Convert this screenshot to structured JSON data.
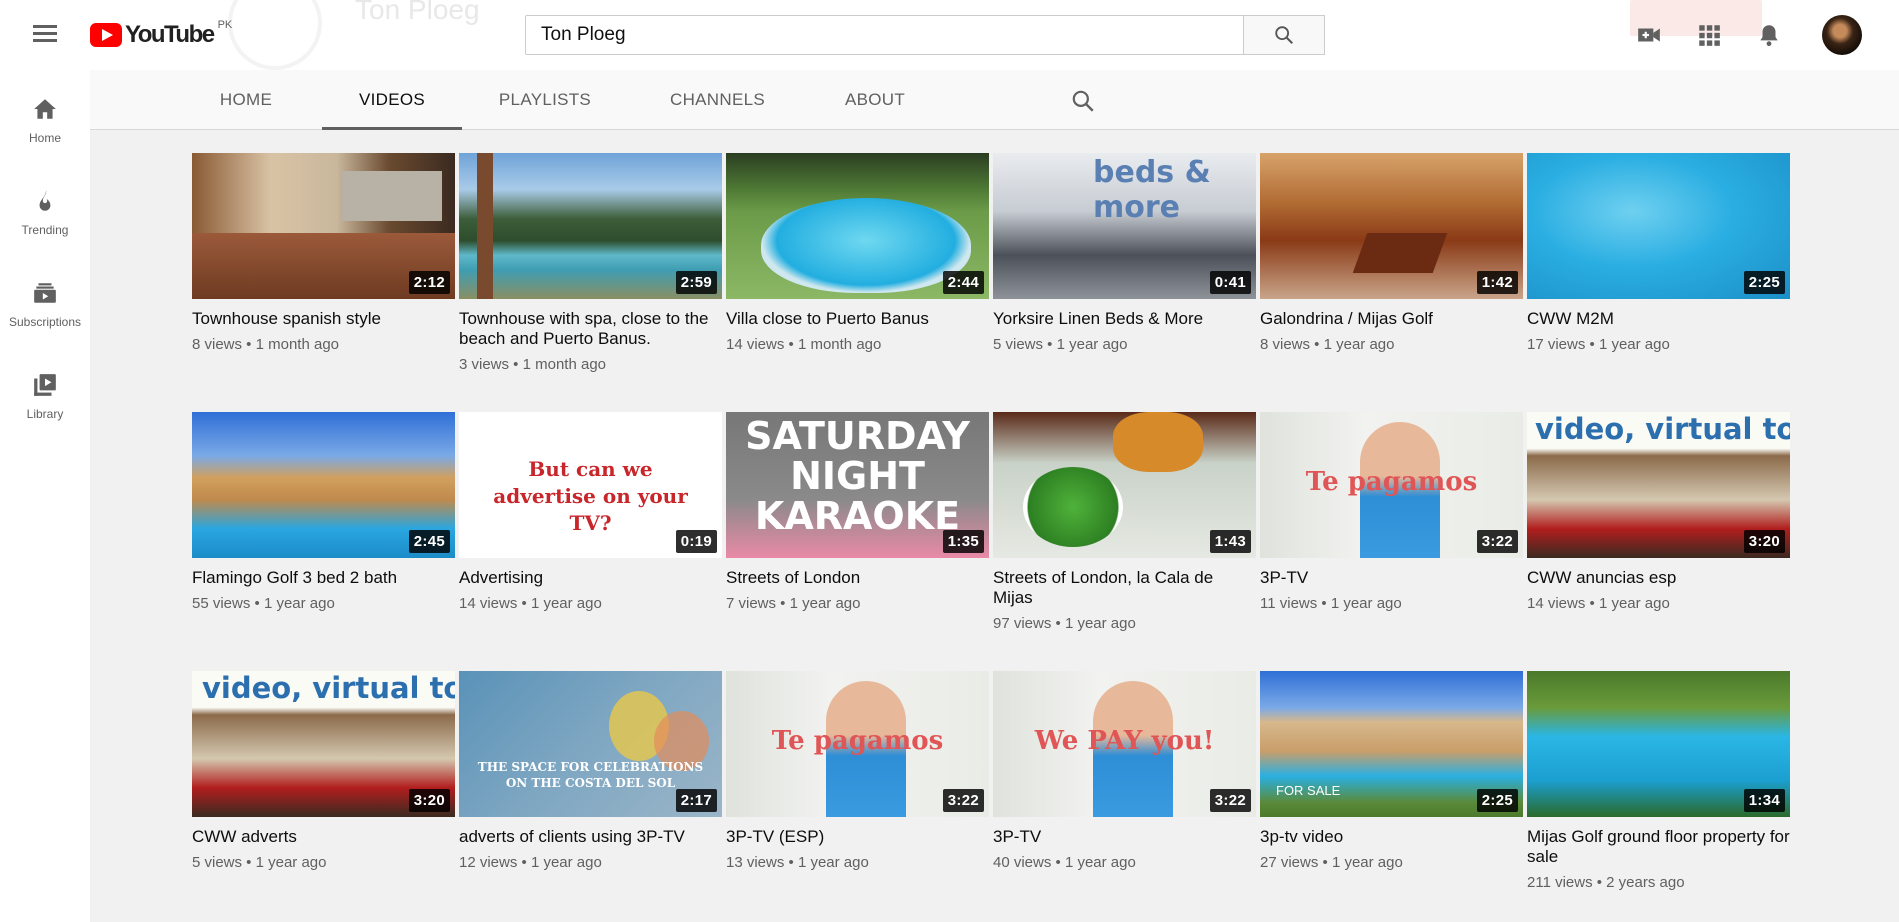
{
  "header": {
    "logo_text": "YouTube",
    "country_code": "PK",
    "channel_name": "Ton Ploeg",
    "search_value": "Ton Ploeg",
    "icons": [
      "menu-icon",
      "search-icon",
      "create-video-icon",
      "apps-grid-icon",
      "notifications-bell-icon",
      "avatar"
    ]
  },
  "sidebar": {
    "items": [
      {
        "label": "Home",
        "icon": "home-icon"
      },
      {
        "label": "Trending",
        "icon": "flame-icon"
      },
      {
        "label": "Subscriptions",
        "icon": "subscriptions-icon"
      },
      {
        "label": "Library",
        "icon": "library-icon"
      }
    ]
  },
  "tabs": [
    {
      "label": "HOME",
      "active": false
    },
    {
      "label": "VIDEOS",
      "active": true
    },
    {
      "label": "PLAYLISTS",
      "active": false
    },
    {
      "label": "CHANNELS",
      "active": false
    },
    {
      "label": "ABOUT",
      "active": false
    }
  ],
  "videos": [
    {
      "title": "Townhouse spanish style",
      "meta": "8 views • 1 month ago",
      "duration": "2:12",
      "overlay": ""
    },
    {
      "title": "Townhouse with spa, close to the beach and Puerto Banus.",
      "meta": "3 views • 1 month ago",
      "duration": "2:59",
      "overlay": ""
    },
    {
      "title": "Villa close to Puerto Banus",
      "meta": "14 views • 1 month ago",
      "duration": "2:44",
      "overlay": ""
    },
    {
      "title": "Yorksire Linen Beds & More",
      "meta": "5 views • 1 year ago",
      "duration": "0:41",
      "overlay": "beds & more"
    },
    {
      "title": "Galondrina / Mijas Golf",
      "meta": "8 views • 1 year ago",
      "duration": "1:42",
      "overlay": ""
    },
    {
      "title": "CWW M2M",
      "meta": "17 views • 1 year ago",
      "duration": "2:25",
      "overlay": ""
    },
    {
      "title": "Flamingo Golf 3 bed 2 bath",
      "meta": "55 views • 1 year ago",
      "duration": "2:45",
      "overlay": ""
    },
    {
      "title": "Advertising",
      "meta": "14 views • 1 year ago",
      "duration": "0:19",
      "overlay": "But can we advertise on your TV?"
    },
    {
      "title": "Streets of London",
      "meta": "7 views • 1 year ago",
      "duration": "1:35",
      "overlay": "SATURDAY NIGHT KARAOKE"
    },
    {
      "title": "Streets of London, la Cala de Mijas",
      "meta": "97 views • 1 year ago",
      "duration": "1:43",
      "overlay": ""
    },
    {
      "title": "3P-TV",
      "meta": "11 views • 1 year ago",
      "duration": "3:22",
      "overlay": "Te pagamos"
    },
    {
      "title": "CWW anuncias esp",
      "meta": "14 views • 1 year ago",
      "duration": "3:20",
      "overlay": "video, virtual tour"
    },
    {
      "title": "CWW adverts",
      "meta": "5 views • 1 year ago",
      "duration": "3:20",
      "overlay": "video, virtual tour"
    },
    {
      "title": "adverts of clients using 3P-TV",
      "meta": "12 views • 1 year ago",
      "duration": "2:17",
      "overlay": "THE SPACE FOR CELEBRATIONS ON THE COSTA DEL SOL"
    },
    {
      "title": "3P-TV (ESP)",
      "meta": "13 views • 1 year ago",
      "duration": "3:22",
      "overlay": "Te pagamos"
    },
    {
      "title": "3P-TV",
      "meta": "40 views • 1 year ago",
      "duration": "3:22",
      "overlay": "We PAY you!"
    },
    {
      "title": "3p-tv video",
      "meta": "27 views • 1 year ago",
      "duration": "2:25",
      "overlay": "FOR SALE"
    },
    {
      "title": "Mijas Golf ground floor property for sale",
      "meta": "211 views • 2 years ago",
      "duration": "1:34",
      "overlay": ""
    }
  ],
  "colors": {
    "brand_red": "#ff0000",
    "background": "#f1f1f1",
    "text_secondary": "#606060"
  }
}
